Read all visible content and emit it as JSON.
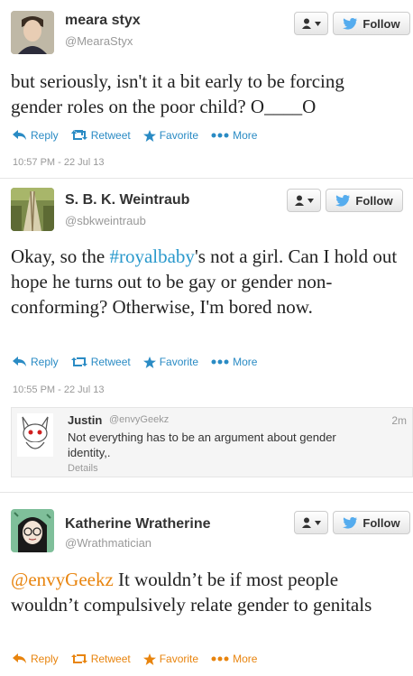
{
  "tweets": [
    {
      "name": "meara styx",
      "handle": "@MearaStyx",
      "text": "but seriously, isn't it a bit early to be forcing gender roles on the poor child? O____O",
      "follow_label": "Follow",
      "actions": {
        "reply": "Reply",
        "retweet": "Retweet",
        "favorite": "Favorite",
        "more": "More"
      },
      "timestamp": "10:57 PM - 22 Jul 13"
    },
    {
      "name": "S. B. K. Weintraub",
      "handle": "@sbkweintraub",
      "text_before": "Okay, so the ",
      "hashtag": "#royalbaby",
      "text_after": "'s not a girl. Can I hold out hope he turns out to be gay or gender non-conforming? Otherwise, I'm bored now.",
      "follow_label": "Follow",
      "actions": {
        "reply": "Reply",
        "retweet": "Retweet",
        "favorite": "Favorite",
        "more": "More"
      },
      "timestamp": "10:55 PM - 22 Jul 13"
    },
    {
      "name": "Katherine Wratherine",
      "handle": "@Wrathmatician",
      "mention": "@envyGeekz",
      "text_after": " It wouldn’t be if most people wouldn’t compulsively relate gender to genitals",
      "follow_label": "Follow",
      "actions": {
        "reply": "Reply",
        "retweet": "Retweet",
        "favorite": "Favorite",
        "more": "More"
      }
    }
  ],
  "reply": {
    "name": "Justin",
    "handle": "@envyGeekz",
    "time": "2m",
    "text": "Not everything has to be an argument about gender identity,.",
    "details": "Details"
  },
  "colors": {
    "link_blue": "#2a8bc4",
    "favorite_orange": "#e8840e",
    "bird_blue": "#55acee"
  }
}
